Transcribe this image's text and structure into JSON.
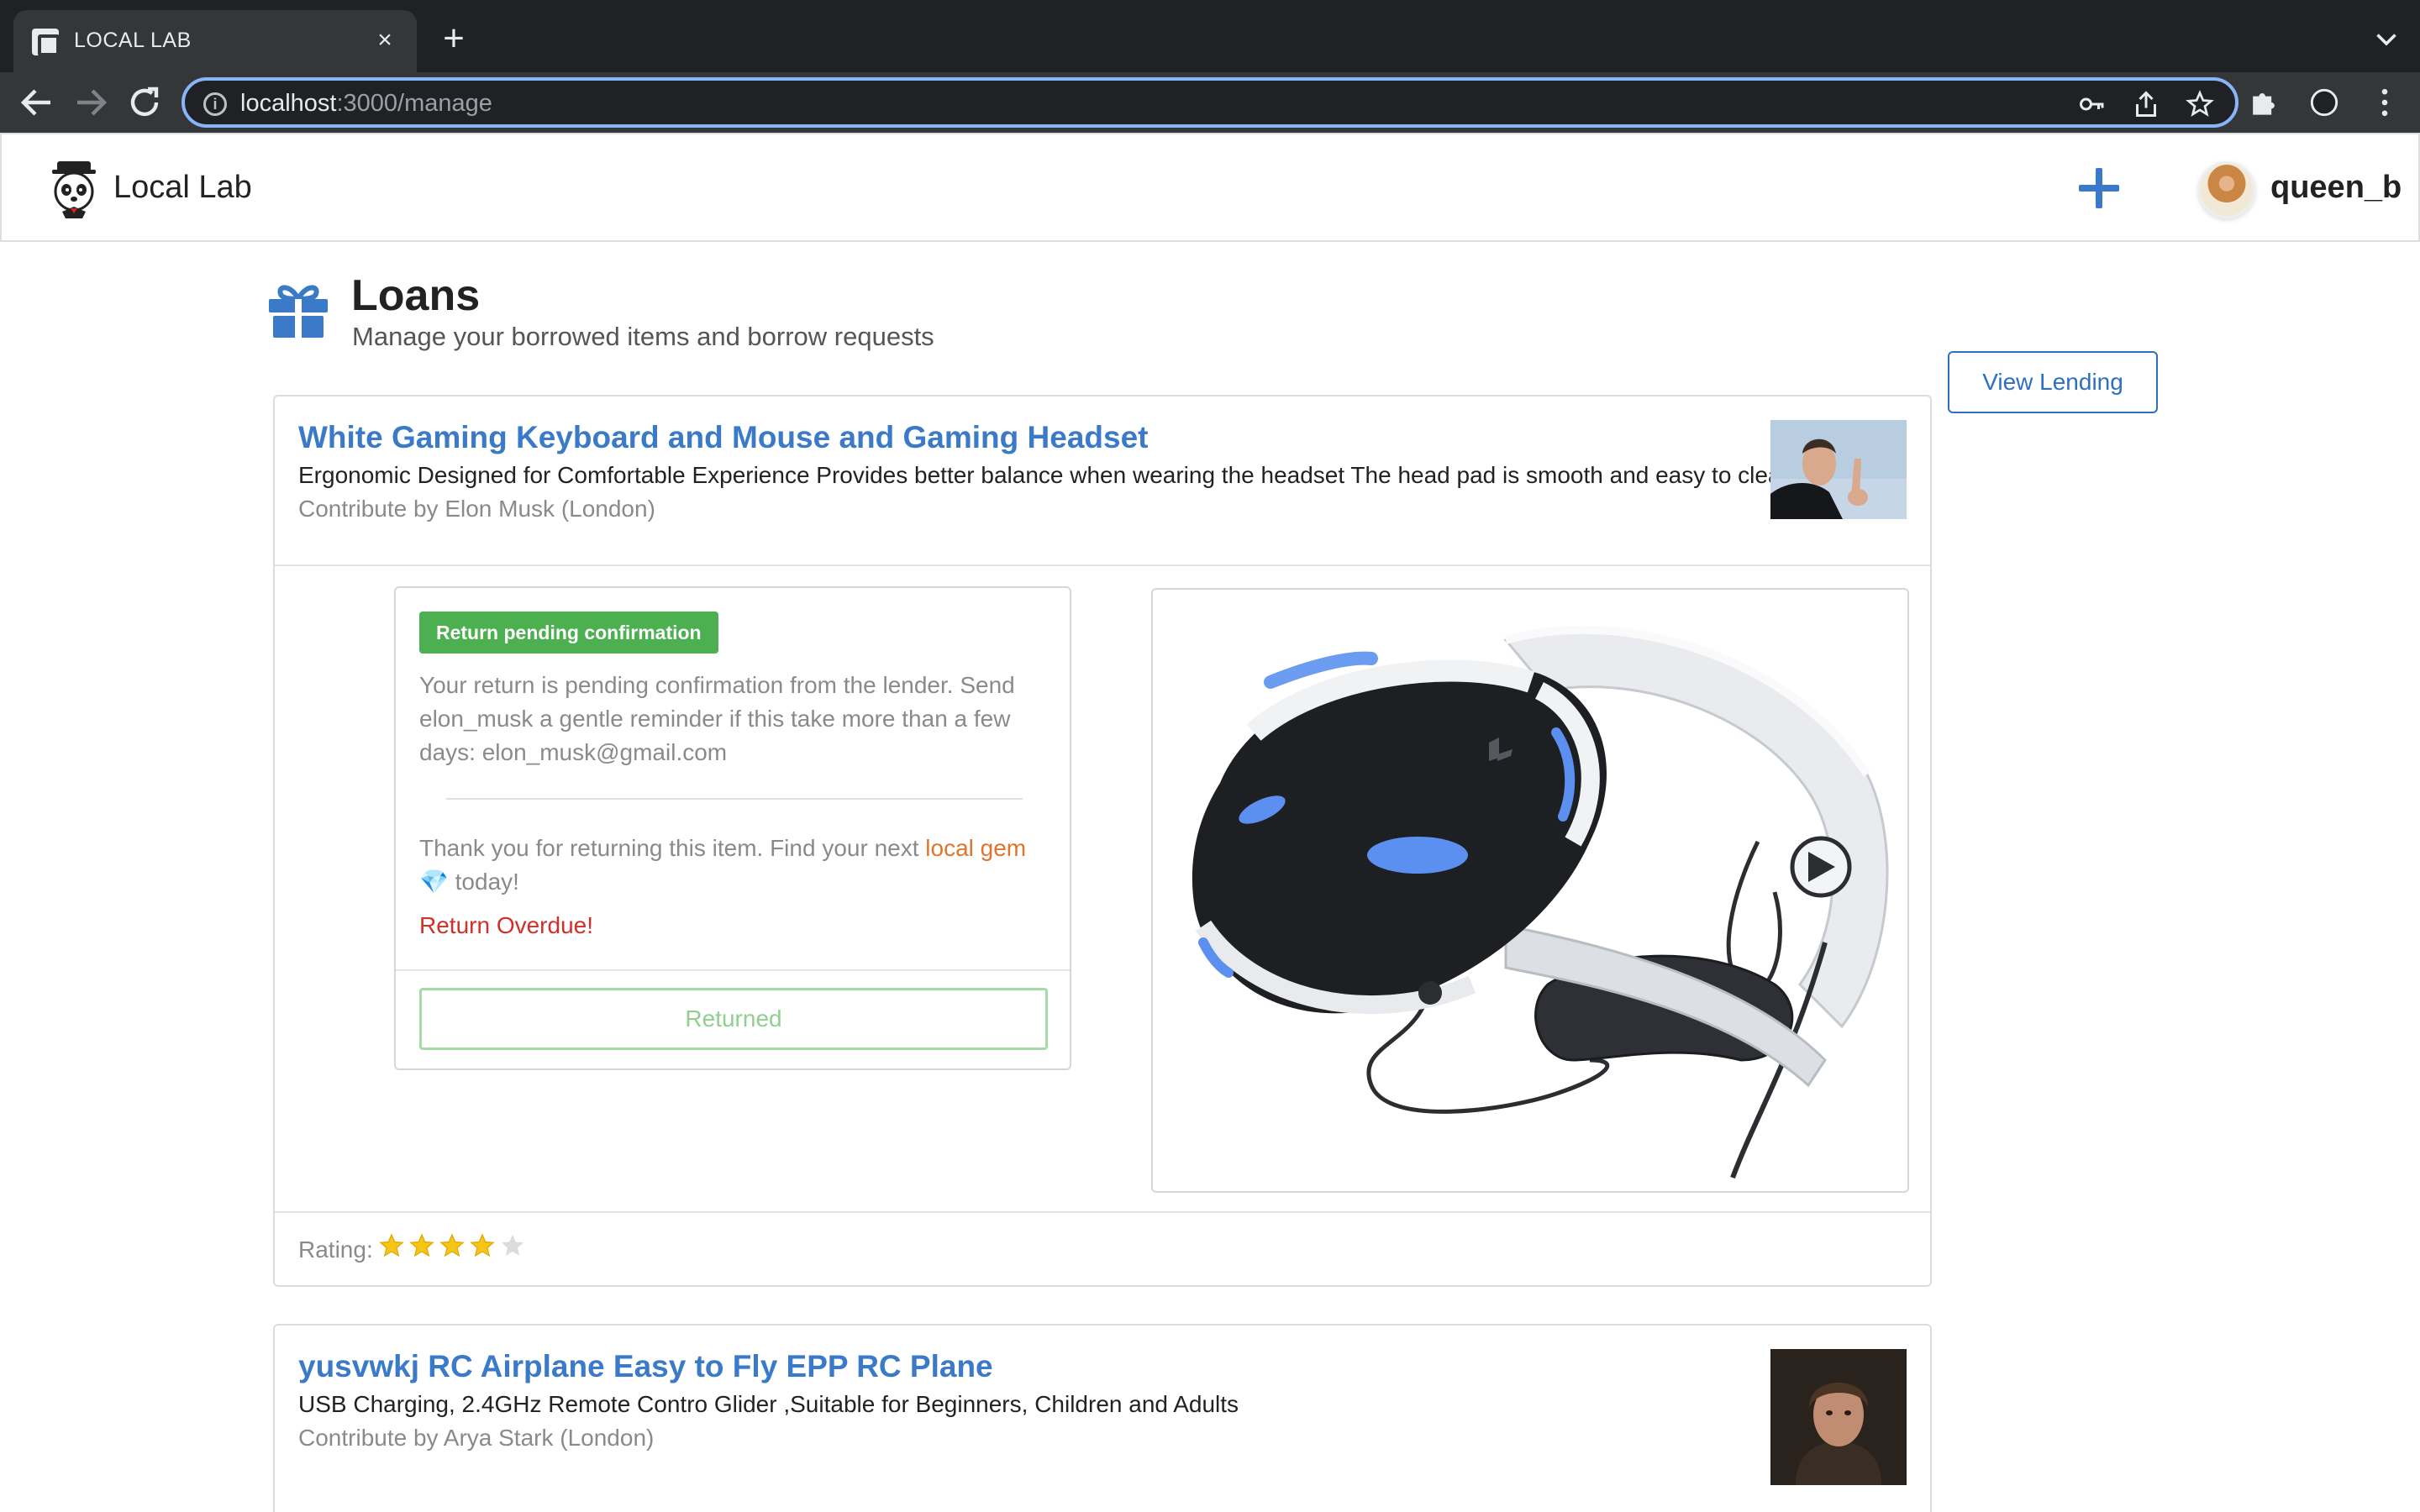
{
  "browser": {
    "tab_title": "LOCAL LAB",
    "url_host": "localhost",
    "url_path": ":3000/manage"
  },
  "header": {
    "brand": "Local Lab",
    "username": "queen_b"
  },
  "page": {
    "title": "Loans",
    "subtitle": "Manage your borrowed items and borrow requests",
    "view_lending_label": "View Lending"
  },
  "loans": [
    {
      "title": "White Gaming Keyboard and Mouse and Gaming Headset",
      "description": "Ergonomic Designed for Comfortable Experience Provides better balance when wearing the headset The head pad is smooth and easy to clean",
      "contributor": "Contribute by Elon Musk (London)",
      "status_badge": "Return pending confirmation",
      "status_text": "Your return is pending confirmation from the lender. Send elon_musk a gentle reminder if this take more than a few days: elon_musk@gmail.com",
      "thanks_before": "Thank you for returning this item. Find your next ",
      "thanks_link": "local gem",
      "thanks_gem": "💎",
      "thanks_after": " today!",
      "overdue": "Return Overdue!",
      "action_label": "Returned",
      "rating_label": "Rating:",
      "rating": 4,
      "rating_max": 5
    },
    {
      "title": "yusvwkj RC Airplane Easy to Fly EPP RC Plane",
      "description": "USB Charging, 2.4GHz Remote Contro Glider ,Suitable for Beginners, Children and Adults",
      "contributor": "Contribute by Arya Stark (London)"
    }
  ],
  "colors": {
    "link_blue": "#3a7ac8",
    "badge_green": "#4caf50",
    "overdue_red": "#d0302a",
    "gem_orange": "#e0742b",
    "star_gold": "#f5c518"
  }
}
